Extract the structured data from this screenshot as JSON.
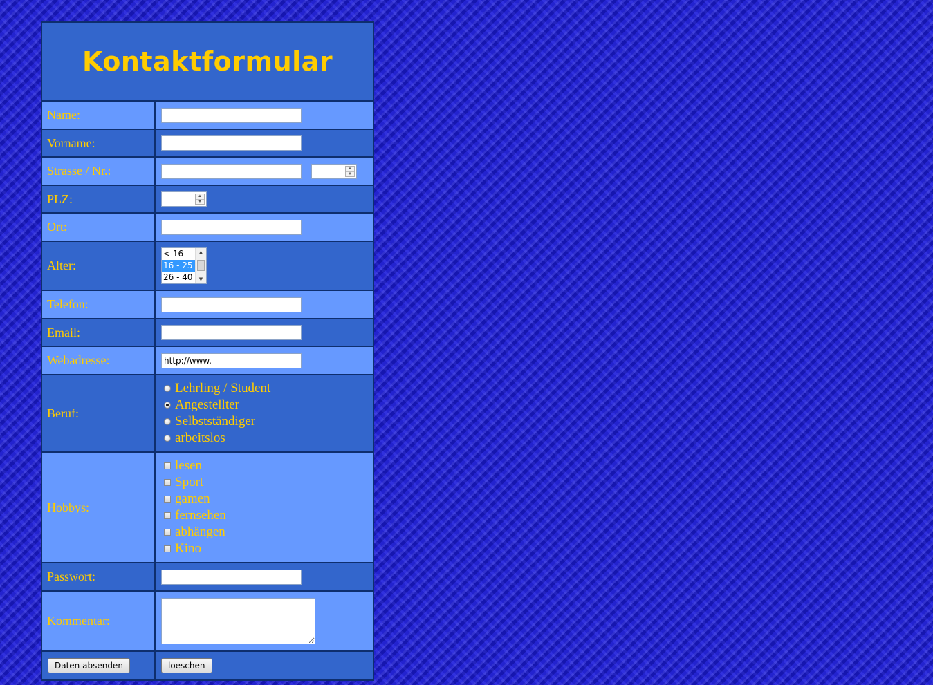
{
  "form": {
    "title": "Kontaktformular",
    "fields": {
      "name_label": "Name:",
      "name_value": "",
      "vorname_label": "Vorname:",
      "vorname_value": "",
      "strasse_label": "Strasse / Nr.:",
      "strasse_value": "",
      "nr_value": "",
      "plz_label": "PLZ:",
      "plz_value": "",
      "ort_label": "Ort:",
      "ort_value": "",
      "alter_label": "Alter:",
      "alter_options": [
        "< 16",
        "16 - 25",
        "26 - 40"
      ],
      "alter_selected": "16 - 25",
      "telefon_label": "Telefon:",
      "telefon_value": "",
      "email_label": "Email:",
      "email_value": "",
      "webadresse_label": "Webadresse:",
      "webadresse_value": "http://www.",
      "beruf_label": "Beruf:",
      "beruf_options": [
        "Lehrling / Student",
        "Angestellter",
        "Selbstständiger",
        "arbeitslos"
      ],
      "beruf_selected": "Angestellter",
      "hobbys_label": "Hobbys:",
      "hobbys_options": [
        "lesen",
        "Sport",
        "gamen",
        "fernsehen",
        "abhängen",
        "Kino"
      ],
      "passwort_label": "Passwort:",
      "passwort_value": "",
      "kommentar_label": "Kommentar:",
      "kommentar_value": ""
    },
    "buttons": {
      "submit_label": "Daten absenden",
      "reset_label": "loeschen"
    }
  },
  "colors": {
    "label_text": "#ffcc00",
    "row_light": "#6699ff",
    "row_dark": "#3366cc",
    "border": "#0e2e6e",
    "page_background": "#1f1fd6"
  }
}
